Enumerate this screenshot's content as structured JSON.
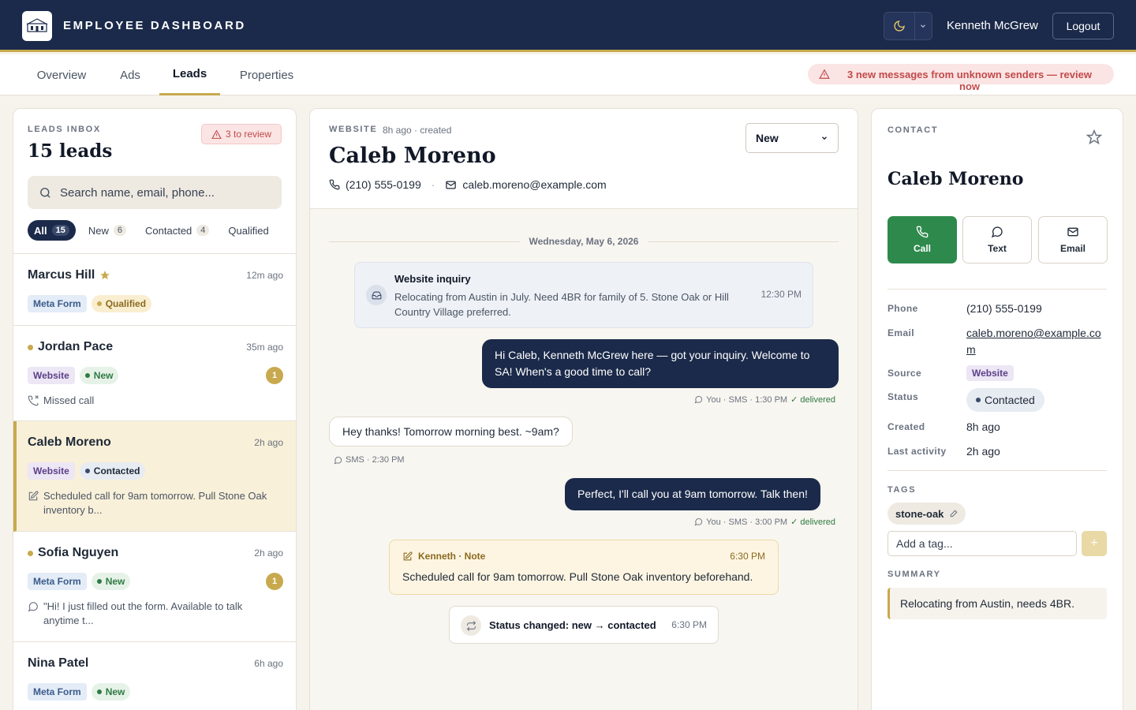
{
  "header": {
    "title": "EMPLOYEE DASHBOARD",
    "user_name": "Kenneth McGrew",
    "logout_label": "Logout",
    "logo_icon": "brand-logo",
    "theme_icon": "moon-icon"
  },
  "tabs": [
    {
      "label": "Overview",
      "active": false
    },
    {
      "label": "Ads",
      "active": false
    },
    {
      "label": "Leads",
      "active": true
    },
    {
      "label": "Properties",
      "active": false
    }
  ],
  "alert_banner": {
    "text": "3 new messages from unknown senders — review now",
    "icon": "warning-icon"
  },
  "inbox": {
    "label": "LEADS INBOX",
    "count_text": "15 leads",
    "review_badge": "3 to review",
    "search_placeholder": "Search name, email, phone...",
    "filters": [
      {
        "label": "All",
        "count": "15",
        "active": true
      },
      {
        "label": "New",
        "count": "6",
        "active": false
      },
      {
        "label": "Contacted",
        "count": "4",
        "active": false
      },
      {
        "label": "Qualified",
        "count": "",
        "active": false
      }
    ],
    "leads": [
      {
        "name": "Marcus Hill",
        "time": "12m ago",
        "source": "Meta Form",
        "status": "Qualified",
        "starred": true,
        "unread_dot": false,
        "unread_count": "",
        "snippet": "",
        "snippet_icon": ""
      },
      {
        "name": "Jordan Pace",
        "time": "35m ago",
        "source": "Website",
        "status": "New",
        "starred": false,
        "unread_dot": true,
        "unread_count": "1",
        "snippet": "Missed call",
        "snippet_icon": "missed-call-icon"
      },
      {
        "name": "Caleb Moreno",
        "time": "2h ago",
        "source": "Website",
        "status": "Contacted",
        "starred": false,
        "unread_dot": false,
        "unread_count": "",
        "snippet": "Scheduled call for 9am tomorrow. Pull Stone Oak inventory b...",
        "snippet_icon": "note-icon",
        "selected": true
      },
      {
        "name": "Sofia Nguyen",
        "time": "2h ago",
        "source": "Meta Form",
        "status": "New",
        "starred": false,
        "unread_dot": true,
        "unread_count": "1",
        "snippet": "\"Hi! I just filled out the form. Available to talk anytime t...",
        "snippet_icon": "chat-icon"
      },
      {
        "name": "Nina Patel",
        "time": "6h ago",
        "source": "Meta Form",
        "status": "New",
        "starred": false,
        "unread_dot": false,
        "unread_count": "",
        "snippet": "",
        "snippet_icon": ""
      }
    ]
  },
  "conversation": {
    "source_label": "WEBSITE",
    "created": "8h ago · created",
    "name": "Caleb Moreno",
    "phone": "(210) 555-0199",
    "email": "caleb.moreno@example.com",
    "status_select": "New",
    "date_separator": "Wednesday, May 6, 2026",
    "inquiry": {
      "title": "Website inquiry",
      "body": "Relocating from Austin in July. Need 4BR for family of 5. Stone Oak or Hill Country Village preferred.",
      "time": "12:30 PM"
    },
    "messages": [
      {
        "dir": "out",
        "text": "Hi Caleb, Kenneth McGrew here — got your inquiry. Welcome to SA! When's a good time to call?",
        "meta": "You · SMS · 1:30 PM",
        "delivered": "✓ delivered"
      },
      {
        "dir": "in",
        "text": "Hey thanks! Tomorrow morning best. ~9am?",
        "meta": "SMS · 2:30 PM"
      },
      {
        "dir": "out",
        "text": "Perfect, I'll call you at 9am tomorrow. Talk then!",
        "meta": "You · SMS · 3:00 PM",
        "delivered": "✓ delivered"
      }
    ],
    "note": {
      "author": "Kenneth · Note",
      "time": "6:30 PM",
      "text": "Scheduled call for 9am tomorrow. Pull Stone Oak inventory beforehand."
    },
    "status_change": {
      "text": "Status changed: new → contacted",
      "time": "6:30 PM"
    }
  },
  "contact": {
    "label": "CONTACT",
    "name": "Caleb Moreno",
    "actions": [
      "Call",
      "Text",
      "Email"
    ],
    "details": [
      {
        "key": "Phone",
        "value": "(210) 555-0199"
      },
      {
        "key": "Email",
        "value": "caleb.moreno@example.com"
      },
      {
        "key": "Source",
        "value": "Website"
      },
      {
        "key": "Status",
        "value": "Contacted"
      },
      {
        "key": "Created",
        "value": "8h ago"
      },
      {
        "key": "Last activity",
        "value": "2h ago"
      }
    ],
    "tags_label": "TAGS",
    "tags": [
      "stone-oak"
    ],
    "tag_placeholder": "Add a tag...",
    "add_tag_label": "+",
    "summary_label": "SUMMARY",
    "summary": "Relocating from Austin, needs 4BR."
  },
  "colors": {
    "navy": "#1b2a4a",
    "gold": "#c8a94e",
    "green": "#2e8a4c",
    "danger": "#c24a4a"
  }
}
